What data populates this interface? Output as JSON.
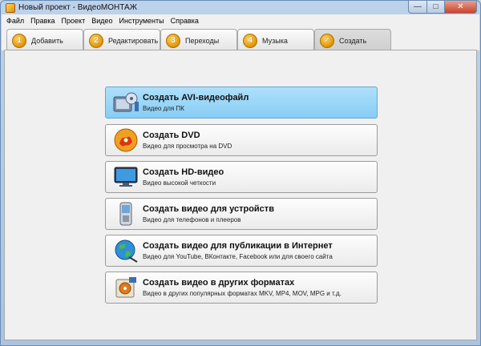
{
  "window": {
    "title": "Новый проект - ВидеоМОНТАЖ",
    "controls": {
      "minimize": "—",
      "maximize": "□",
      "close": "✕"
    }
  },
  "menu": [
    "Файл",
    "Правка",
    "Проект",
    "Видео",
    "Инструменты",
    "Справка"
  ],
  "tabs": [
    {
      "number": "1",
      "label": "Добавить",
      "active": false
    },
    {
      "number": "2",
      "label": "Редактировать",
      "active": false
    },
    {
      "number": "3",
      "label": "Переходы",
      "active": false
    },
    {
      "number": "4",
      "label": "Музыка",
      "active": false
    },
    {
      "number": "✓",
      "label": "Создать",
      "active": true
    }
  ],
  "options": [
    {
      "title": "Создать AVI-видеофайл",
      "subtitle": "Видео для ПК",
      "icon": "film-reel-icon",
      "selected": true
    },
    {
      "title": "Создать DVD",
      "subtitle": "Видео для просмотра на DVD",
      "icon": "dvd-disc-icon",
      "selected": false
    },
    {
      "title": "Создать HD-видео",
      "subtitle": "Видео высокой четкости",
      "icon": "hd-monitor-icon",
      "selected": false
    },
    {
      "title": "Создать видео для устройств",
      "subtitle": "Видео для телефонов и плееров",
      "icon": "mobile-phone-icon",
      "selected": false
    },
    {
      "title": "Создать видео для публикации в Интернет",
      "subtitle": "Видео для YouTube, ВКонтакте, Facebook или для своего сайта",
      "icon": "globe-icon",
      "selected": false
    },
    {
      "title": "Создать видео в других форматах",
      "subtitle": "Видео в других популярных форматах MKV, MP4, MOV, MPG и т.д.",
      "icon": "film-formats-icon",
      "selected": false
    }
  ],
  "colors": {
    "selected_option": "#9fd8f8",
    "tab_badge": "#e8a000",
    "titlebar": "#bcd2ea"
  }
}
